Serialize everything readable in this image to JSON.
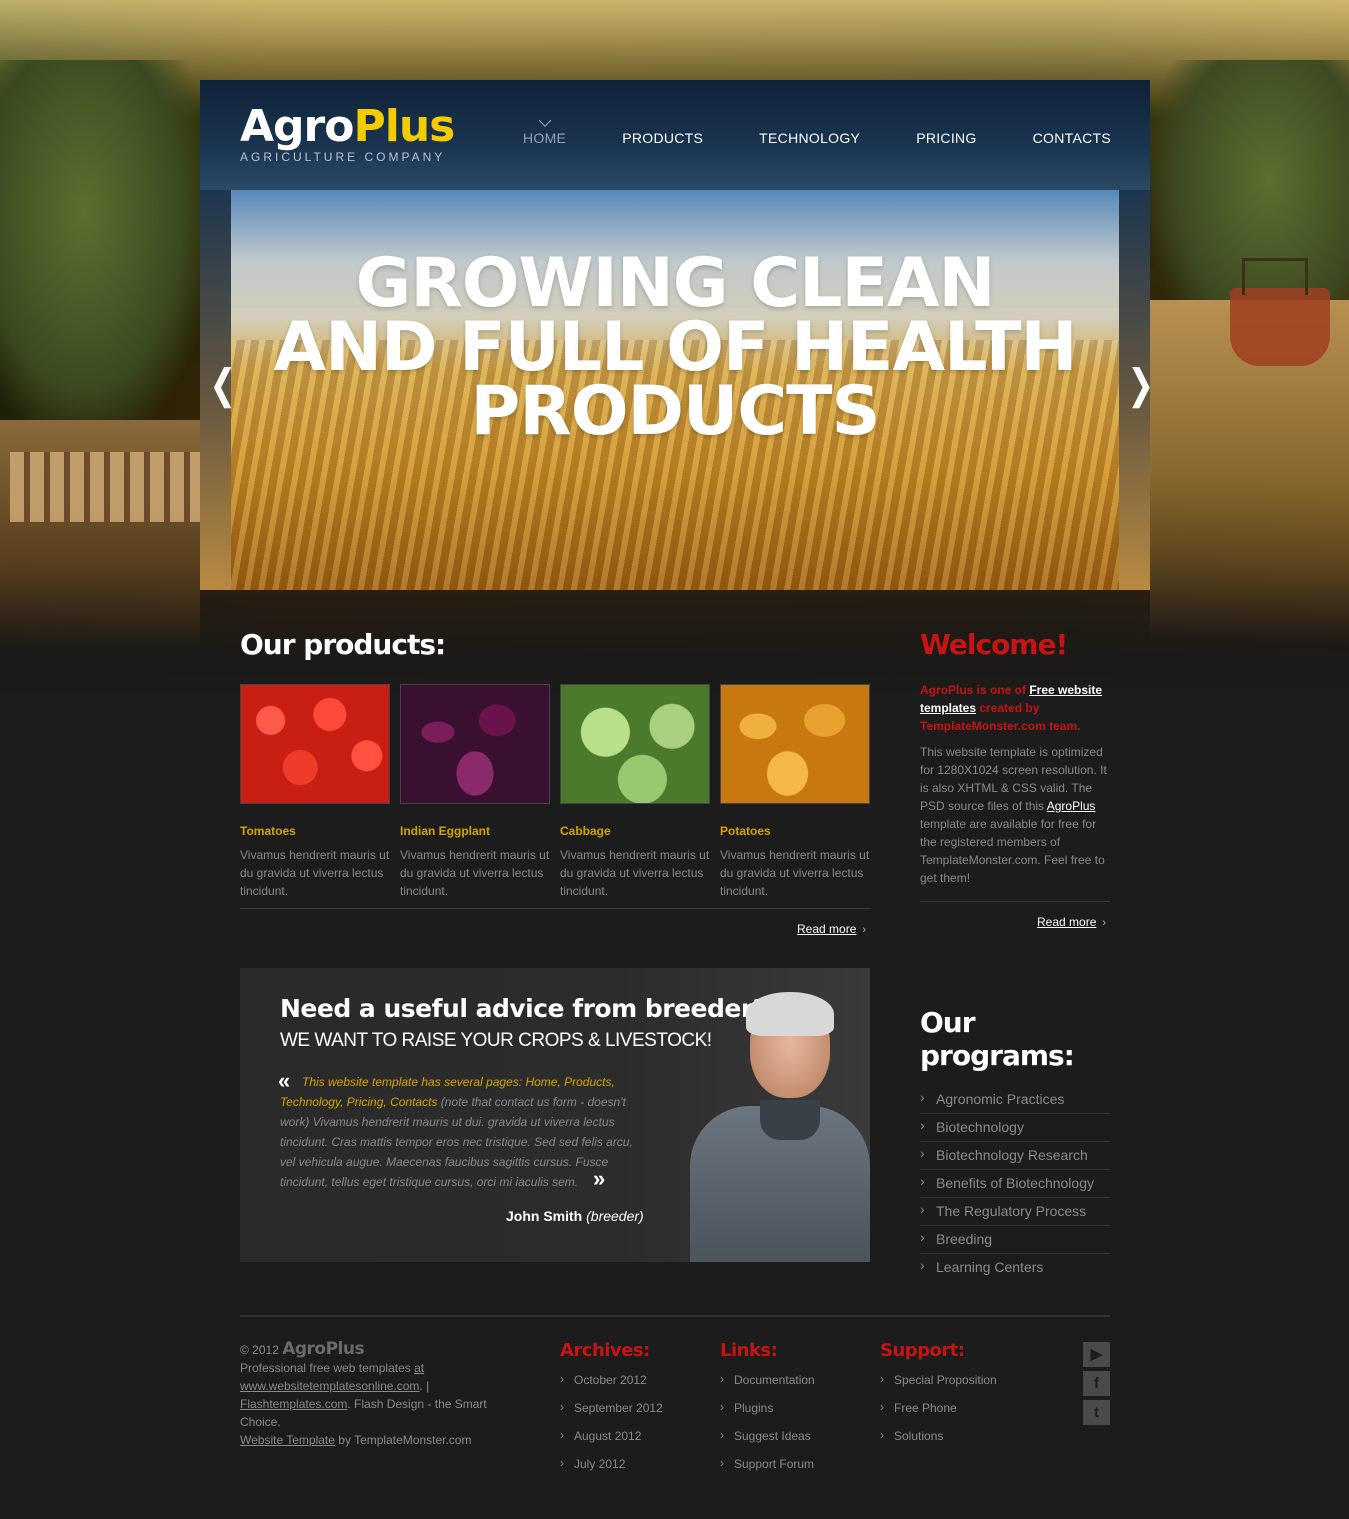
{
  "brand": {
    "name_part1": "Agro",
    "name_part2": "Plus",
    "tagline": "AGRICULTURE COMPANY"
  },
  "nav": {
    "items": [
      {
        "label": "HOME",
        "active": true
      },
      {
        "label": "PRODUCTS"
      },
      {
        "label": "TECHNOLOGY"
      },
      {
        "label": "PRICING"
      },
      {
        "label": "CONTACTS"
      }
    ]
  },
  "slider": {
    "lines": [
      "GROWING CLEAN",
      "AND FULL OF HEALTH",
      "PRODUCTS"
    ],
    "prev_icon": "❬",
    "next_icon": "❭"
  },
  "products": {
    "title": "Our products:",
    "items": [
      {
        "name": "Tomatoes",
        "desc": "Vivamus hendrerit mauris ut du gravida ut viverra lectus tincidunt."
      },
      {
        "name": "Indian Eggplant",
        "desc": "Vivamus hendrerit mauris ut du gravida ut viverra lectus tincidunt."
      },
      {
        "name": "Cabbage",
        "desc": "Vivamus hendrerit mauris ut du gravida ut viverra lectus tincidunt."
      },
      {
        "name": "Potatoes",
        "desc": "Vivamus hendrerit mauris ut du gravida ut viverra lectus tincidunt."
      }
    ],
    "read_more": "Read more"
  },
  "welcome": {
    "title": "Welcome!",
    "lead_prefix": "AgroPlus is one of ",
    "lead_link": "Free website templates",
    "lead_suffix": " created by TemplateMonster.com team.",
    "body_prefix": "This website template is optimized for 1280X1024 screen resolution. It is also XHTML & CSS valid. The PSD source files of this ",
    "body_link": "AgroPlus",
    "body_suffix": " template are available for free for the registered members of TemplateMonster.com. Feel free to get them!",
    "read_more": "Read more"
  },
  "advice": {
    "title": "Need a useful advice from breeder?",
    "subtitle": "WE WANT TO RAISE YOUR CROPS & LIVESTOCK!",
    "quote_highlight": "This website template has several pages: Home, Products, Technology, Pricing, Contacts",
    "quote_rest": " (note that contact us form - doesn't work) Vivamus hendrerit mauris ut dui. gravida ut viverra lectus tincidunt. Cras mattis tempor eros nec tristique. Sed sed felis arcu, vel vehicula augue. Maecenas faucibus sagittis cursus. Fusce tincidunt, tellus eget tristique cursus, orci mi iaculis sem.",
    "author_name": "John Smith",
    "author_role": "(breeder)",
    "quote_open": "«",
    "quote_close": "»"
  },
  "programs": {
    "title": "Our programs:",
    "items": [
      "Agronomic Practices",
      "Biotechnology",
      "Biotechnology Research",
      "Benefits of Biotechnology",
      "The Regulatory Process",
      "Breeding",
      "Learning Centers"
    ]
  },
  "footer": {
    "copyright": "© 2012",
    "brand": "AgroPlus",
    "line1_prefix": "Professional free web templates ",
    "line1_link1": "at www.websitetemplatesonline.com",
    "line1_sep": ". | ",
    "line1_link2": "Flashtemplates.com",
    "line1_suffix": ". Flash Design - the Smart Choice.",
    "line2_link": "Website Template",
    "line2_suffix": " by TemplateMonster.com",
    "archives": {
      "title": "Archives:",
      "items": [
        "October 2012",
        "September 2012",
        "August 2012",
        "July 2012"
      ]
    },
    "links": {
      "title": "Links:",
      "items": [
        "Documentation",
        "Plugins",
        "Suggest Ideas",
        "Support Forum"
      ]
    },
    "support": {
      "title": "Support:",
      "items": [
        "Special Proposition",
        "Free Phone",
        "Solutions"
      ]
    },
    "social": [
      {
        "icon": "youtube-icon",
        "glyph": "▶"
      },
      {
        "icon": "facebook-icon",
        "glyph": "f"
      },
      {
        "icon": "twitter-icon",
        "glyph": "t"
      }
    ]
  },
  "colors": {
    "accent_yellow": "#f2cb00",
    "accent_red": "#c41414",
    "product_name": "#d4a300",
    "background": "#1c1c1c"
  }
}
